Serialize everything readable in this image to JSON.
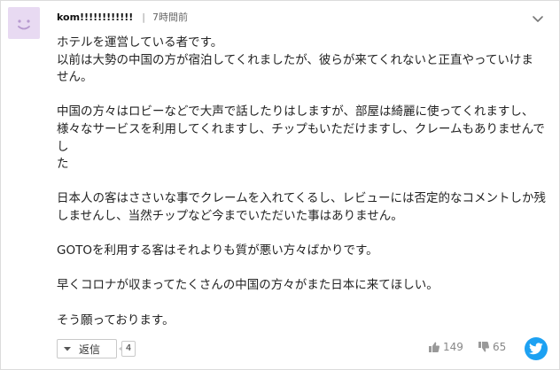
{
  "comment": {
    "username": "kom!!!!!!!!!!!!",
    "time": "7時間前",
    "paragraphs": [
      "ホテルを運営している者です。\n以前は大勢の中国の方が宿泊してくれましたが、彼らが来てくれないと正直やっていけま\nせん。",
      "中国の方々はロビーなどで大声で話したりはしますが、部屋は綺麗に使ってくれますし、\n様々なサービスを利用してくれますし、チップもいただけますし、クレームもありませんでし\nた",
      "日本人の客はささいな事でクレームを入れてくるし、レビューには否定的なコメントしか残\nしませんし、当然チップなど今までいただいた事はありません。",
      "GOTOを利用する客はそれよりも質が悪い方々ばかりです。",
      "早くコロナが収まってたくさんの中国の方々がまた日本に来てほしい。",
      "そう願っております。"
    ]
  },
  "actions": {
    "reply_label": "返信",
    "reply_count": "4",
    "like_count": "149",
    "dislike_count": "65"
  },
  "icons": {
    "avatar": "smiley-avatar-icon",
    "more": "more-options-icon",
    "reply_caret": "caret-down-icon",
    "like": "thumbs-up-icon",
    "dislike": "thumbs-down-icon",
    "share": "twitter-icon"
  },
  "colors": {
    "avatar_bg": "#e8daf2",
    "avatar_face": "#b79ad0",
    "twitter": "#1da1f2",
    "text": "#222222"
  }
}
